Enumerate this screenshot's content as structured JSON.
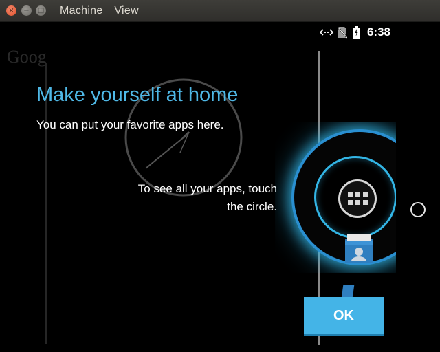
{
  "window": {
    "menu": [
      "Machine",
      "View"
    ],
    "close_glyph": "×",
    "min_glyph": "−",
    "max_glyph": "□"
  },
  "statusbar": {
    "time": "6:38",
    "icons": [
      "data-transfer-icon",
      "no-sim-icon",
      "battery-charging-icon"
    ]
  },
  "home": {
    "google_ghost": "Goog"
  },
  "cling": {
    "title": "Make yourself at home",
    "subtitle": "You can put your favorite apps here.",
    "hint_line1": "To see all your apps, touch",
    "hint_line2": "the circle.",
    "ok_label": "OK"
  },
  "colors": {
    "accent": "#33b5e5",
    "title": "#4fb8e6",
    "ok_button": "#44b4e7"
  }
}
